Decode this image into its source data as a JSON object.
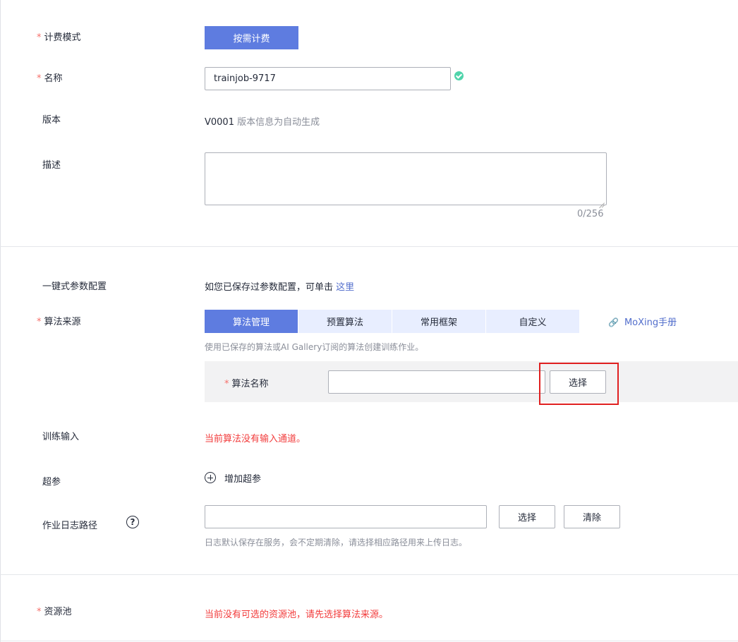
{
  "billing": {
    "label": "计费模式",
    "button": "按需计费"
  },
  "name": {
    "label": "名称",
    "value": "trainjob-9717"
  },
  "version": {
    "label": "版本",
    "value": "V0001",
    "hint": "版本信息为自动生成"
  },
  "description": {
    "label": "描述",
    "value": "",
    "counter": "0/256"
  },
  "oneclick": {
    "label": "一键式参数配置",
    "text": "如您已保存过参数配置，可单击",
    "link": "这里"
  },
  "algorithm_source": {
    "label": "算法来源",
    "tabs": [
      "算法管理",
      "预置算法",
      "常用框架",
      "自定义"
    ],
    "moxing_link": "MoXing手册",
    "hint": "使用已保存的算法或AI Gallery订阅的算法创建训练作业。",
    "algo_name_label": "算法名称",
    "algo_name_value": "",
    "select_button": "选择"
  },
  "training_input": {
    "label": "训练输入",
    "error": "当前算法没有输入通道。"
  },
  "hyperparams": {
    "label": "超参",
    "add_button": "增加超参"
  },
  "log_path": {
    "label": "作业日志路径",
    "help": "?",
    "value": "",
    "select_button": "选择",
    "clear_button": "清除",
    "hint": "日志默认保存在服务，会不定期清除，请选择相应路径用来上传日志。"
  },
  "resource_pool": {
    "label": "资源池",
    "error": "当前没有可选的资源池，请先选择算法来源。"
  },
  "required_mark": "*",
  "colors": {
    "accent": "#5e7ce0",
    "required": "#f66f6a",
    "error": "#f23c3c",
    "highlight": "#e02020",
    "success": "#50d4ab"
  }
}
